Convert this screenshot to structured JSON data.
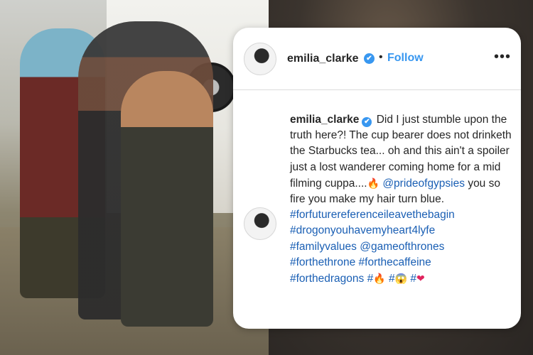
{
  "post": {
    "username": "emilia_clarke",
    "verified_mark": "✔",
    "separator": "•",
    "follow_label": "Follow",
    "more_label": "•••",
    "caption": {
      "text_1": "Did I just stumble upon the truth here?! The cup bearer does not drinketh the Starbucks tea... oh and this ain't a spoiler just a lost wanderer coming home for a mid filming cuppa....",
      "fire_emoji": "🔥",
      "mention_1": "@prideofgypsies",
      "text_2": "you so fire you make my hair turn blue.",
      "hashtag_1": "#forfuturereferenceileavethebagin",
      "hashtag_2": "#drogonyouhavemyheart4lyfe",
      "hashtag_3": "#familyvalues",
      "mention_2": "@gameofthrones",
      "hashtag_4": "#forthethrone",
      "hashtag_5": "#forthecaffeine",
      "hashtag_6": "#forthedragons",
      "hash_1": "#",
      "emoji_fire_2": "🔥",
      "hash_2": "#",
      "emoji_2": "😱",
      "hash_3": "#",
      "emoji_heart": "❤"
    }
  },
  "colors": {
    "accent": "#3897f0",
    "link": "#1a5fb4",
    "text": "#262626",
    "heart": "#e0245e"
  },
  "icons": {
    "avatar": "profile-avatar",
    "verified": "verified-badge-icon",
    "more": "more-options-icon"
  }
}
